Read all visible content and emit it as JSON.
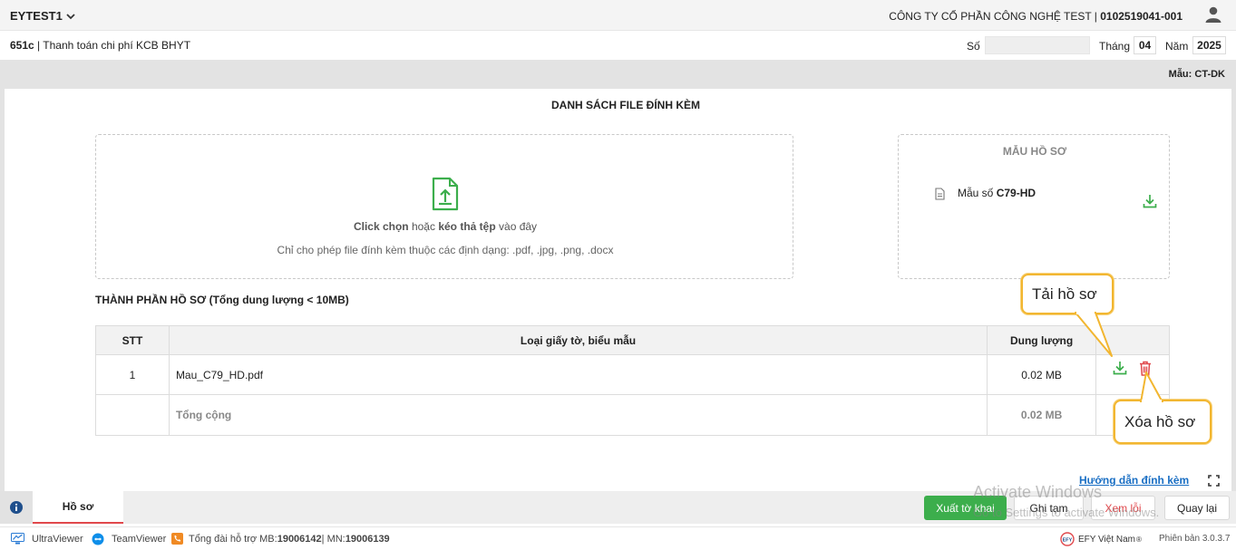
{
  "header": {
    "org_code": "EYTEST1",
    "company_name": "CÔNG TY CỔ PHẦN CÔNG NGHỆ TEST | ",
    "tax_code": "0102519041-001"
  },
  "doc": {
    "code": "651c",
    "title": " | Thanh toán chi phí KCB BHYT",
    "so_label": "Số",
    "so_value": "",
    "thang_label": "Tháng",
    "thang_value": "04",
    "nam_label": "Năm",
    "nam_value": "2025",
    "mau_label": "Mẫu: ",
    "mau_value": "CT-DK"
  },
  "attachments": {
    "heading": "DANH SÁCH FILE ĐÍNH KÈM",
    "upload_click": "Click chọn",
    "upload_or": " hoặc ",
    "upload_drag": "kéo thả tệp",
    "upload_here": " vào đây",
    "upload_note": "Chỉ cho phép file đính kèm thuộc các định dạng: .pdf, .jpg, .png, .docx",
    "template_heading": "MẪU HỒ SƠ",
    "template_item_prefix": "Mẫu số ",
    "template_item_code": "C79-HD"
  },
  "components": {
    "heading": "THÀNH PHẦN HỒ SƠ (Tổng dung lượng < 10MB)",
    "columns": {
      "stt": "STT",
      "type": "Loại giấy tờ, biểu mẫu",
      "size": "Dung lượng"
    },
    "rows": [
      {
        "stt": "1",
        "name": "Mau_C79_HD.pdf",
        "size": "0.02 MB"
      }
    ],
    "total_label": "Tổng cộng",
    "total_size": "0.02 MB"
  },
  "callouts": {
    "download": "Tải hồ sơ",
    "delete": "Xóa hồ sơ"
  },
  "guide_link": "Hướng dẫn đính kèm",
  "bottom": {
    "tab": "Hồ sơ",
    "buttons": {
      "export": "Xuất tờ khai",
      "save_draft": "Ghi tạm",
      "view_errors": "Xem lỗi",
      "back": "Quay lại"
    },
    "watermark_title": "Activate Windows",
    "watermark_sub": "Go to Settings to activate Windows."
  },
  "footer": {
    "ultraviewer": "UltraViewer",
    "teamviewer": "TeamViewer",
    "hotline_label": "Tổng đài hỗ trợ MB: ",
    "hotline_mb": "19006142",
    "hotline_sep": " | MN: ",
    "hotline_mn": "19006139",
    "brand": "EFY Việt Nam",
    "version": "Phiên bản 3.0.3.7"
  },
  "colors": {
    "accent_green": "#3cae4c",
    "danger_red": "#e0484c",
    "link_blue": "#1a6fc4",
    "callout_border": "#f2b630"
  }
}
